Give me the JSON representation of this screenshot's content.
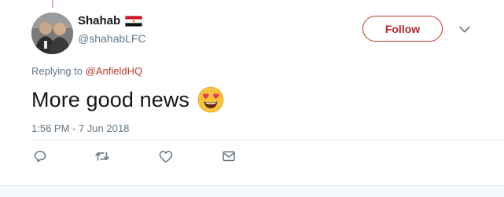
{
  "tweet": {
    "author": {
      "display_name": "Shahab",
      "handle": "@shahabLFC",
      "flag_icon": "egypt-flag-icon",
      "avatar_icon": "avatar"
    },
    "follow_label": "Follow",
    "reply_prefix": "Replying to",
    "reply_mention": "@AnfieldHQ",
    "text": "More good news",
    "emoji_icon": "heart-eyes-emoji-icon",
    "timestamp": "1:56 PM - 7 Jun 2018",
    "actions": [
      {
        "name": "reply",
        "icon": "reply-icon"
      },
      {
        "name": "retweet",
        "icon": "retweet-icon"
      },
      {
        "name": "like",
        "icon": "heart-icon"
      },
      {
        "name": "direct-message",
        "icon": "envelope-icon"
      }
    ]
  },
  "colors": {
    "accent": "#b3262e",
    "secondary_text": "#657786",
    "primary_text": "#14171a",
    "divider": "#e6ecf0"
  }
}
